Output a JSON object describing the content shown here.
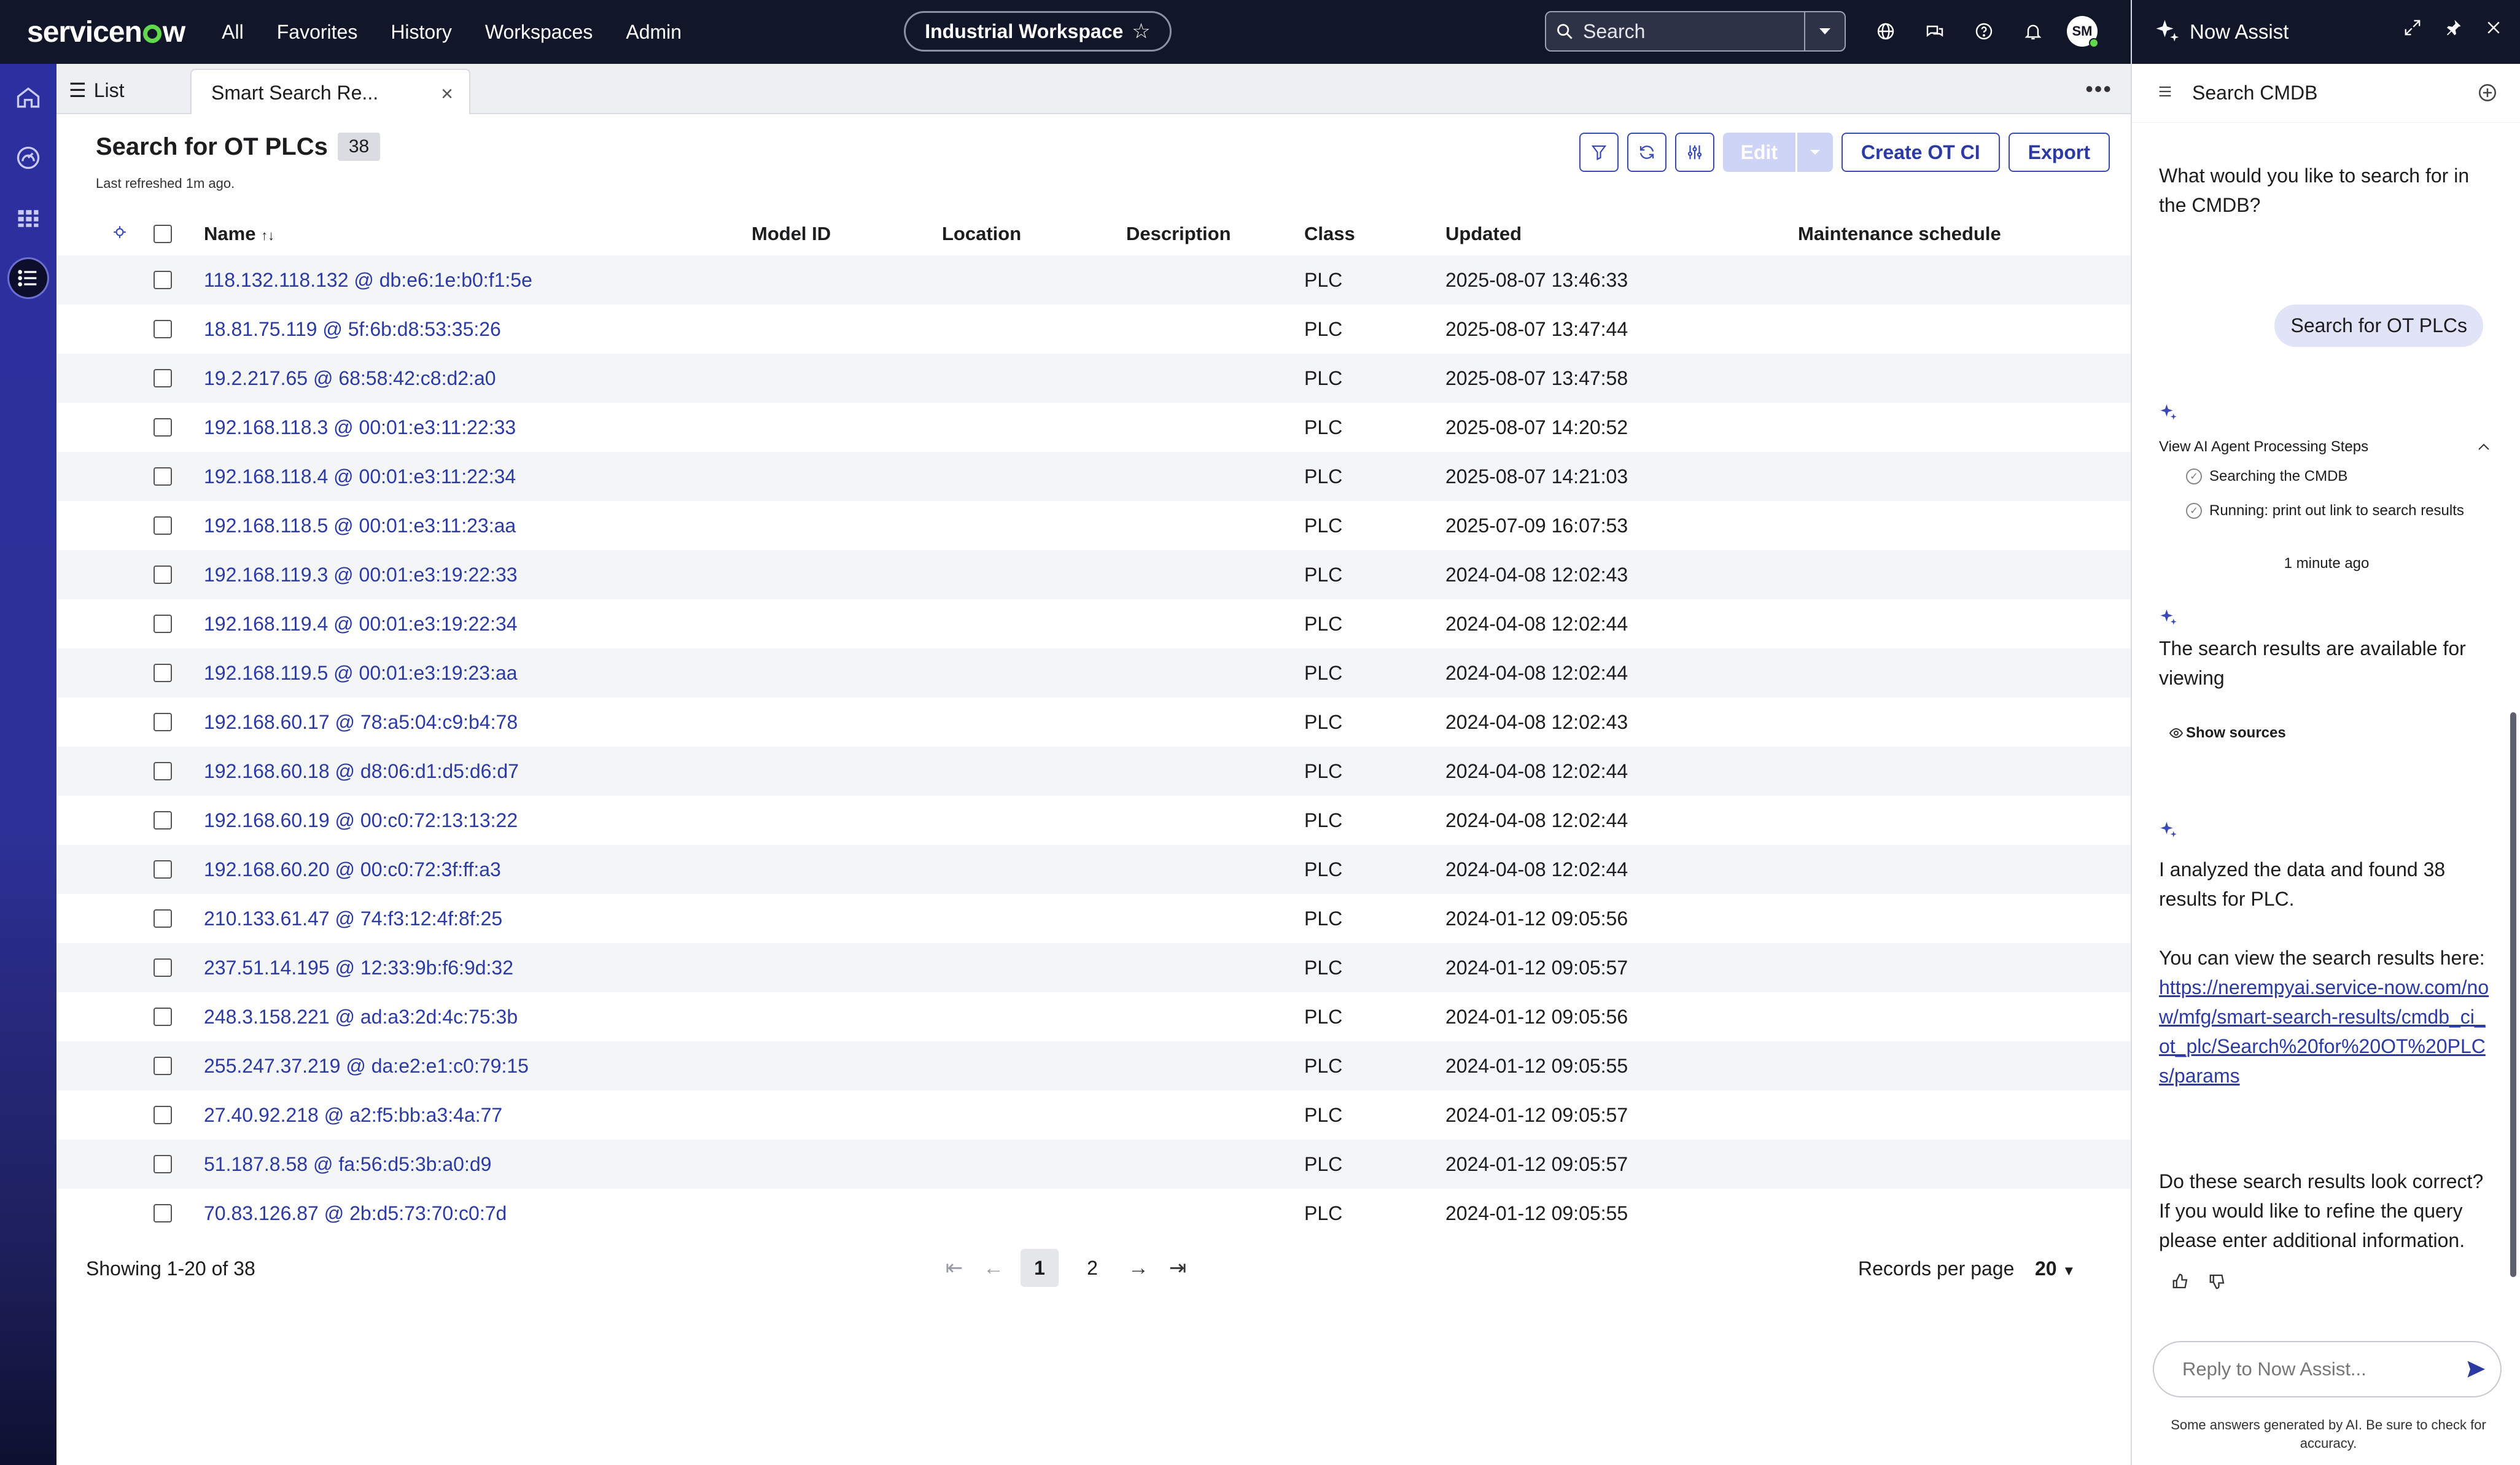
{
  "topbar": {
    "logo": "servicenow",
    "nav": [
      "All",
      "Favorites",
      "History",
      "Workspaces",
      "Admin"
    ],
    "workspace": "Industrial Workspace",
    "search_placeholder": "Search",
    "avatar_initials": "SM"
  },
  "tabs": {
    "list_label": "List",
    "active_label": "Smart Search Re..."
  },
  "list": {
    "title": "Search for OT PLCs",
    "count": "38",
    "last_refreshed": "Last refreshed 1m ago.",
    "edit_label": "Edit",
    "create_label": "Create OT CI",
    "export_label": "Export",
    "columns": {
      "name": "Name",
      "model": "Model ID",
      "location": "Location",
      "description": "Description",
      "class": "Class",
      "updated": "Updated",
      "maintenance": "Maintenance schedule"
    },
    "rows": [
      {
        "name": "118.132.118.132 @ db:e6:1e:b0:f1:5e",
        "class": "PLC",
        "updated": "2025-08-07 13:46:33"
      },
      {
        "name": "18.81.75.119 @ 5f:6b:d8:53:35:26",
        "class": "PLC",
        "updated": "2025-08-07 13:47:44"
      },
      {
        "name": "19.2.217.65 @ 68:58:42:c8:d2:a0",
        "class": "PLC",
        "updated": "2025-08-07 13:47:58"
      },
      {
        "name": "192.168.118.3 @ 00:01:e3:11:22:33",
        "class": "PLC",
        "updated": "2025-08-07 14:20:52"
      },
      {
        "name": "192.168.118.4 @ 00:01:e3:11:22:34",
        "class": "PLC",
        "updated": "2025-08-07 14:21:03"
      },
      {
        "name": "192.168.118.5 @ 00:01:e3:11:23:aa",
        "class": "PLC",
        "updated": "2025-07-09 16:07:53"
      },
      {
        "name": "192.168.119.3 @ 00:01:e3:19:22:33",
        "class": "PLC",
        "updated": "2024-04-08 12:02:43"
      },
      {
        "name": "192.168.119.4 @ 00:01:e3:19:22:34",
        "class": "PLC",
        "updated": "2024-04-08 12:02:44"
      },
      {
        "name": "192.168.119.5 @ 00:01:e3:19:23:aa",
        "class": "PLC",
        "updated": "2024-04-08 12:02:44"
      },
      {
        "name": "192.168.60.17 @ 78:a5:04:c9:b4:78",
        "class": "PLC",
        "updated": "2024-04-08 12:02:43"
      },
      {
        "name": "192.168.60.18 @ d8:06:d1:d5:d6:d7",
        "class": "PLC",
        "updated": "2024-04-08 12:02:44"
      },
      {
        "name": "192.168.60.19 @ 00:c0:72:13:13:22",
        "class": "PLC",
        "updated": "2024-04-08 12:02:44"
      },
      {
        "name": "192.168.60.20 @ 00:c0:72:3f:ff:a3",
        "class": "PLC",
        "updated": "2024-04-08 12:02:44"
      },
      {
        "name": "210.133.61.47 @ 74:f3:12:4f:8f:25",
        "class": "PLC",
        "updated": "2024-01-12 09:05:56"
      },
      {
        "name": "237.51.14.195 @ 12:33:9b:f6:9d:32",
        "class": "PLC",
        "updated": "2024-01-12 09:05:57"
      },
      {
        "name": "248.3.158.221 @ ad:a3:2d:4c:75:3b",
        "class": "PLC",
        "updated": "2024-01-12 09:05:56"
      },
      {
        "name": "255.247.37.219 @ da:e2:e1:c0:79:15",
        "class": "PLC",
        "updated": "2024-01-12 09:05:55"
      },
      {
        "name": "27.40.92.218 @ a2:f5:bb:a3:4a:77",
        "class": "PLC",
        "updated": "2024-01-12 09:05:57"
      },
      {
        "name": "51.187.8.58 @ fa:56:d5:3b:a0:d9",
        "class": "PLC",
        "updated": "2024-01-12 09:05:57"
      },
      {
        "name": "70.83.126.87 @ 2b:d5:73:70:c0:7d",
        "class": "PLC",
        "updated": "2024-01-12 09:05:55"
      }
    ],
    "showing": "Showing 1-20 of 38",
    "pages": [
      "1",
      "2"
    ],
    "current_page": "1",
    "records_per_page_label": "Records per page",
    "records_per_page": "20"
  },
  "assist": {
    "title": "Now Assist",
    "subheader": "Search CMDB",
    "question": "What would you like to search for in the CMDB?",
    "user_message": "Search for OT PLCs",
    "steps_header": "View AI Agent Processing Steps",
    "steps": [
      "Searching the CMDB",
      "Running: print out link to search results"
    ],
    "timestamp": "1 minute ago",
    "results_msg": "The search results are available for viewing",
    "show_sources": "Show sources",
    "analysis_msg": "I analyzed the data and found 38 results for PLC.",
    "view_msg": "You can view the search results here:",
    "link": "https://nerempyai.service-now.com/now/mfg/smart-search-results/cmdb_ci_ot_plc/Search%20for%20OT%20PLCs/params",
    "followup": "Do these search results look correct? If you would like to refine the query please enter additional information.",
    "reply_placeholder": "Reply to Now Assist...",
    "disclaimer": "Some answers generated by AI. Be sure to check for accuracy."
  },
  "colors": {
    "topbar": "#121629",
    "rail": "#2c2f9f",
    "accent": "#2c3aa3",
    "logo_o": "#62d84e",
    "bubble": "#e1e3f7"
  }
}
